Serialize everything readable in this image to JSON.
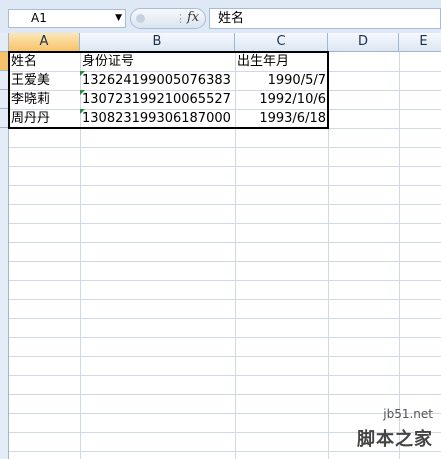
{
  "formula_bar": {
    "name_box": "A1",
    "fx_label": "fx",
    "formula": "姓名"
  },
  "columns": [
    "A",
    "B",
    "C",
    "D",
    "E"
  ],
  "rows": [
    [
      "姓名",
      "身份证号",
      "出生年月"
    ],
    [
      "王爱美",
      "132624199005076383",
      "1990/5/7"
    ],
    [
      "李晓莉",
      "130723199210065527",
      "1992/10/6"
    ],
    [
      "周丹丹",
      "130823199306187000",
      "1993/6/18"
    ]
  ],
  "watermark": {
    "url": "jb51.net",
    "text": "脚本之家"
  },
  "colors": {
    "header_bg": "#dfe8f5",
    "selected_header": "#f7c36a",
    "gridline": "#d0d7e5",
    "text_marker": "#1f8f3a"
  }
}
